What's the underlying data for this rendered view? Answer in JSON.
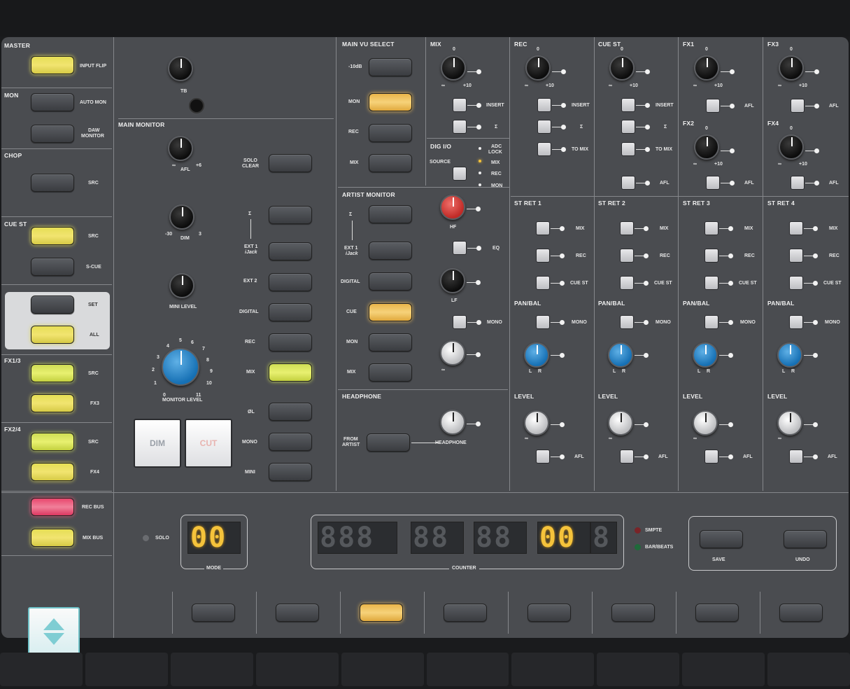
{
  "left": {
    "master": {
      "title": "MASTER",
      "input_flip": "INPUT FLIP"
    },
    "mon": {
      "title": "MON",
      "auto_mon": "AUTO MON",
      "daw_monitor_1": "DAW",
      "daw_monitor_2": "MONITOR"
    },
    "chop": {
      "title": "CHOP",
      "src": "SRC"
    },
    "cue_st": {
      "title": "CUE ST",
      "src": "SRC",
      "s_cue": "S-CUE"
    },
    "sel": {
      "set": "SET",
      "all": "ALL"
    },
    "fx13": {
      "title": "FX1/3",
      "src": "SRC",
      "fx3": "FX3"
    },
    "fx24": {
      "title": "FX2/4",
      "src": "SRC",
      "fx4": "FX4"
    },
    "rec_bus": "REC BUS",
    "mix_bus": "MIX BUS"
  },
  "tb": {
    "tb": "TB"
  },
  "main_monitor": {
    "title": "MAIN MONITOR",
    "afl": "AFL",
    "afl_scale_l": "∞",
    "afl_scale_r": "+6",
    "dim": "DIM",
    "dim_scale_l": "-30",
    "dim_scale_r": "3",
    "mini_level": "MINI LEVEL",
    "monitor_level": "MONITOR LEVEL",
    "scale": [
      "0",
      "1",
      "2",
      "3",
      "4",
      "5",
      "6",
      "7",
      "8",
      "9",
      "10",
      "11"
    ],
    "dim_button": "DIM",
    "cut_button": "CUT",
    "solo_clear_1": "SOLO",
    "solo_clear_2": "CLEAR",
    "sigma": "Σ",
    "ext1": "EXT 1",
    "ijack": "iJack",
    "ext2": "EXT 2",
    "digital": "DIGITAL",
    "rec": "REC",
    "mix": "MIX",
    "ol": "ØL",
    "mono": "MONO",
    "mini": "MINI"
  },
  "main_vu": {
    "title": "MAIN VU SELECT",
    "m10db": "-10dB",
    "mon": "MON",
    "rec": "REC",
    "mix": "MIX"
  },
  "mix": {
    "title": "MIX",
    "zero": "0",
    "inf": "∞",
    "p10": "+10",
    "insert": "INSERT",
    "sigma": "Σ"
  },
  "dig_io": {
    "title": "DIG I/O",
    "adc1": "ADC",
    "adc2": "LOCK",
    "source": "SOURCE",
    "mix": "MIX",
    "rec": "REC",
    "mon": "MON"
  },
  "artist": {
    "title": "ARTIST MONITOR",
    "sigma": "Σ",
    "ext1": "EXT 1",
    "ijack": "iJack",
    "digital": "DIGITAL",
    "cue": "CUE",
    "mon": "MON",
    "mix": "MIX",
    "hf": "HF",
    "eq": "EQ",
    "lf": "LF",
    "mono": "MONO",
    "inf": "∞"
  },
  "headphone": {
    "title": "HEADPHONE",
    "from1": "FROM",
    "from2": "ARTIST",
    "headphone": "HEADPHONE"
  },
  "strips": [
    {
      "title": "REC",
      "insert": "INSERT",
      "sigma": "Σ",
      "to_mix": "TO MIX",
      "ret": "ST RET 1"
    },
    {
      "title": "CUE ST",
      "insert": "INSERT",
      "sigma": "Σ",
      "to_mix": "TO MIX",
      "afl": "AFL",
      "ret": "ST RET 2"
    },
    {
      "title": "FX1",
      "afl": "AFL",
      "sub": "FX2",
      "afl2": "AFL",
      "ret": "ST RET 3"
    },
    {
      "title": "FX3",
      "afl": "AFL",
      "sub": "FX4",
      "afl2": "AFL",
      "ret": "ST RET 4"
    }
  ],
  "strip_common": {
    "mix": "MIX",
    "rec": "REC",
    "cue_st": "CUE ST",
    "pan_bal": "PAN/BAL",
    "mono": "MONO",
    "l": "L",
    "r": "R",
    "level": "LEVEL",
    "afl": "AFL",
    "zero": "0",
    "inf": "∞",
    "p10": "+10"
  },
  "bottom": {
    "solo": "SOLO",
    "mode": "MODE",
    "mode_digits": "00",
    "counter": "COUNTER",
    "counter_groups": [
      "888",
      "88",
      "88",
      "00",
      "8"
    ],
    "smpte": "SMPTE",
    "bar_beats": "BAR/BEATS",
    "save": "SAVE",
    "undo": "UNDO"
  },
  "colors": {
    "panel": "#4a4c50",
    "amber": "#f5c33b",
    "blue": "#1670b4",
    "red": "#c02a26"
  }
}
